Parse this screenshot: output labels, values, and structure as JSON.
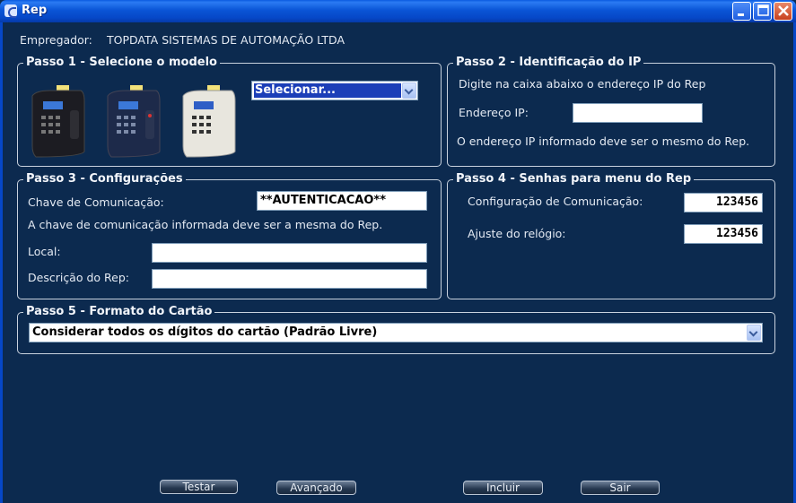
{
  "window": {
    "title": "Rep"
  },
  "employer": {
    "label": "Empregador:",
    "value": "TOPDATA SISTEMAS DE AUTOMAÇÃO LTDA"
  },
  "step1": {
    "legend": "Passo 1 - Selecione o modelo",
    "select_value": "Selecionar...",
    "models": [
      "device-model-black",
      "device-model-dark-blue",
      "device-model-white"
    ]
  },
  "step2": {
    "legend": "Passo 2 - Identificação do IP",
    "instruction": "Digite na caixa abaixo o endereço IP do Rep",
    "ip_label": "Endereço IP:",
    "ip_value": "",
    "note": "O endereço IP informado deve ser o mesmo do Rep."
  },
  "step3": {
    "legend": "Passo 3 - Configurações",
    "key_label": "Chave de Comunicação:",
    "key_value": "**AUTENTICACAO**",
    "key_note": "A chave de comunicação informada deve ser a mesma do Rep.",
    "local_label": "Local:",
    "local_value": "",
    "desc_label": "Descrição do Rep:",
    "desc_value": ""
  },
  "step4": {
    "legend": "Passo 4 - Senhas para menu do Rep",
    "comm_label": "Configuração de Comunicação:",
    "comm_value": "123456",
    "clock_label": "Ajuste do relógio:",
    "clock_value": "123456"
  },
  "step5": {
    "legend": "Passo 5 - Formato do Cartão",
    "select_value": "Considerar todos os dígitos do cartão (Padrão Livre)"
  },
  "buttons": {
    "test": "Testar",
    "advanced": "Avançado",
    "include": "Incluir",
    "exit": "Sair"
  },
  "colors": {
    "background": "#0c2a4f",
    "titlebar": "#0a55d6",
    "border": "#c9d2de"
  }
}
